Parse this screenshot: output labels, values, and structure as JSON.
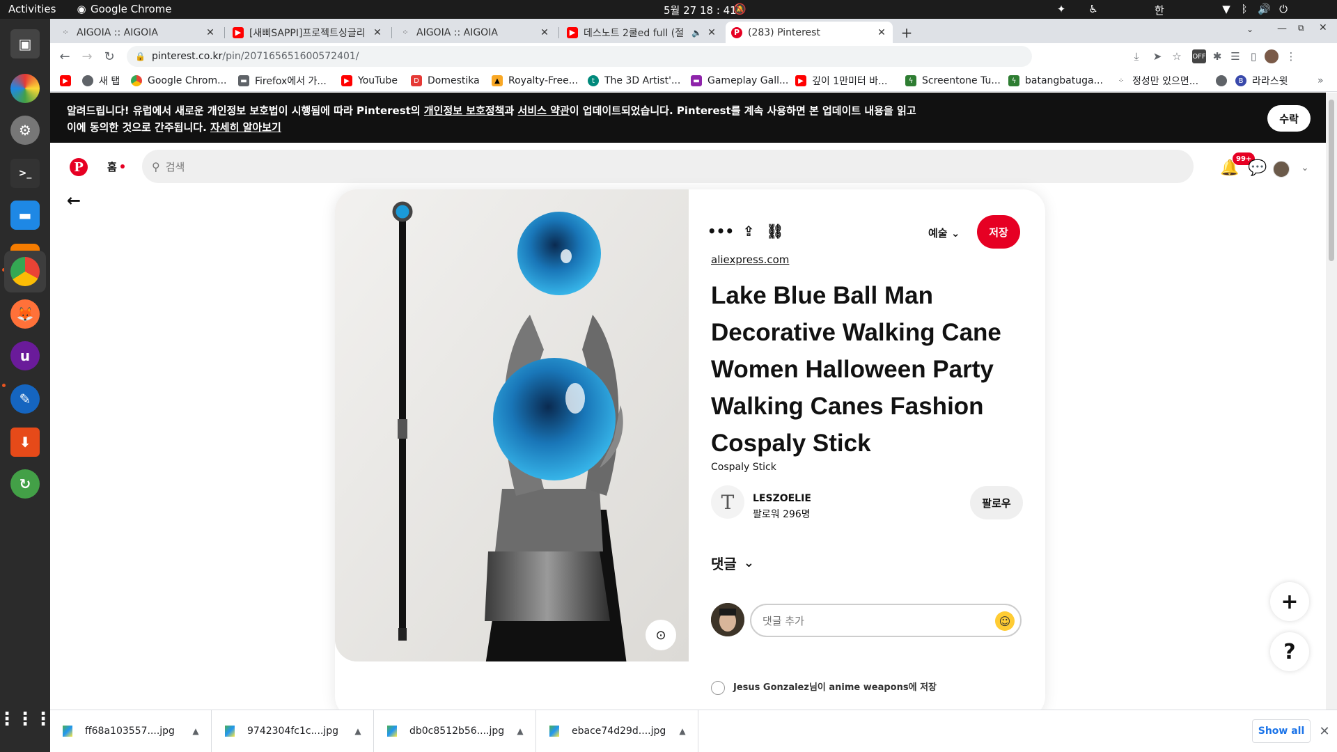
{
  "topbar": {
    "activities": "Activities",
    "app_name": "Google Chrome",
    "datetime": "5월 27  18 : 41",
    "input_method": "한"
  },
  "tabs": [
    {
      "label": "AIGOIA :: AIGOIA",
      "icon": "aigoia-favicon",
      "active": false
    },
    {
      "label": "[새삐SAPPI]프로젝트싱글리",
      "icon": "youtube-favicon",
      "active": false
    },
    {
      "label": "AIGOIA :: AIGOIA",
      "icon": "aigoia-favicon",
      "active": false
    },
    {
      "label": "데스노트 2쿨ed full (절",
      "icon": "youtube-favicon",
      "active": false,
      "audio": true
    },
    {
      "label": "(283) Pinterest",
      "icon": "pinterest-favicon",
      "active": true
    }
  ],
  "toolbar": {
    "url_host": "pinterest.co.kr",
    "url_path": "/pin/207165651600572401/"
  },
  "bookmarks": [
    {
      "label": "",
      "color": "#ff0000"
    },
    {
      "label": "새 탭",
      "color": "#5f6368"
    },
    {
      "label": "Google Chrom...",
      "color": "#4285f4"
    },
    {
      "label": "Firefox에서 가...",
      "color": "#5f6368"
    },
    {
      "label": "YouTube",
      "color": "#ff0000"
    },
    {
      "label": "Domestika",
      "color": "#e53935"
    },
    {
      "label": "Royalty-Free...",
      "color": "#f9a825"
    },
    {
      "label": "The 3D Artist'...",
      "color": "#00897b"
    },
    {
      "label": "Gameplay Gall...",
      "color": "#8e24aa"
    },
    {
      "label": "깊이 1만미터 바...",
      "color": "#ff0000"
    },
    {
      "label": "Screentone Tu...",
      "color": "#2e7d32"
    },
    {
      "label": "batangbatuga...",
      "color": "#2e7d32"
    },
    {
      "label": "정성만 있으면...",
      "color": "#333333"
    },
    {
      "label": "",
      "color": "#5f6368"
    },
    {
      "label": "라라스윗",
      "color": "#3949ab"
    }
  ],
  "notice": {
    "text_1": "알려드립니다! 유럽에서 새로운 개인정보 보호법이 시행됨에 따라 Pinterest의 ",
    "privacy_link": "개인정보 보호정책",
    "text_2": "과 ",
    "terms_link": "서비스 약관",
    "text_3": "이 업데이트되었습니다. Pinterest를 계속 사용하면 본 업데이트 내용을 읽고 이에 동의한 것으로 간주됩니다. ",
    "learn_more": "자세히 알아보기",
    "accept": "수락"
  },
  "header": {
    "home": "홈",
    "search_placeholder": "검색",
    "notification_badge": "99+"
  },
  "pin": {
    "board": "예술",
    "save": "저장",
    "source": "aliexpress.com",
    "title": "Lake Blue Ball Man Decorative Walking Cane Women Halloween Party Walking Canes Fashion Cospaly Stick",
    "description": "Cospaly Stick",
    "creator_name": "LESZOELIE",
    "creator_followers": "팔로워 296명",
    "follow": "팔로우",
    "comments_label": "댓글",
    "comment_placeholder": "댓글 추가",
    "saved_note": "Jesus Gonzalez님이 anime weapons에 저장"
  },
  "floating": {
    "add": "+",
    "help": "?"
  },
  "downloads": {
    "items": [
      {
        "name": "ff68a103557....jpg"
      },
      {
        "name": "9742304fc1c....jpg"
      },
      {
        "name": "db0c8512b56....jpg"
      },
      {
        "name": "ebace74d29d....jpg"
      }
    ],
    "show_all": "Show all"
  },
  "colors": {
    "pinterest_red": "#e60023",
    "notice_bg": "#111111",
    "dock_bg": "#2b2b2b"
  }
}
